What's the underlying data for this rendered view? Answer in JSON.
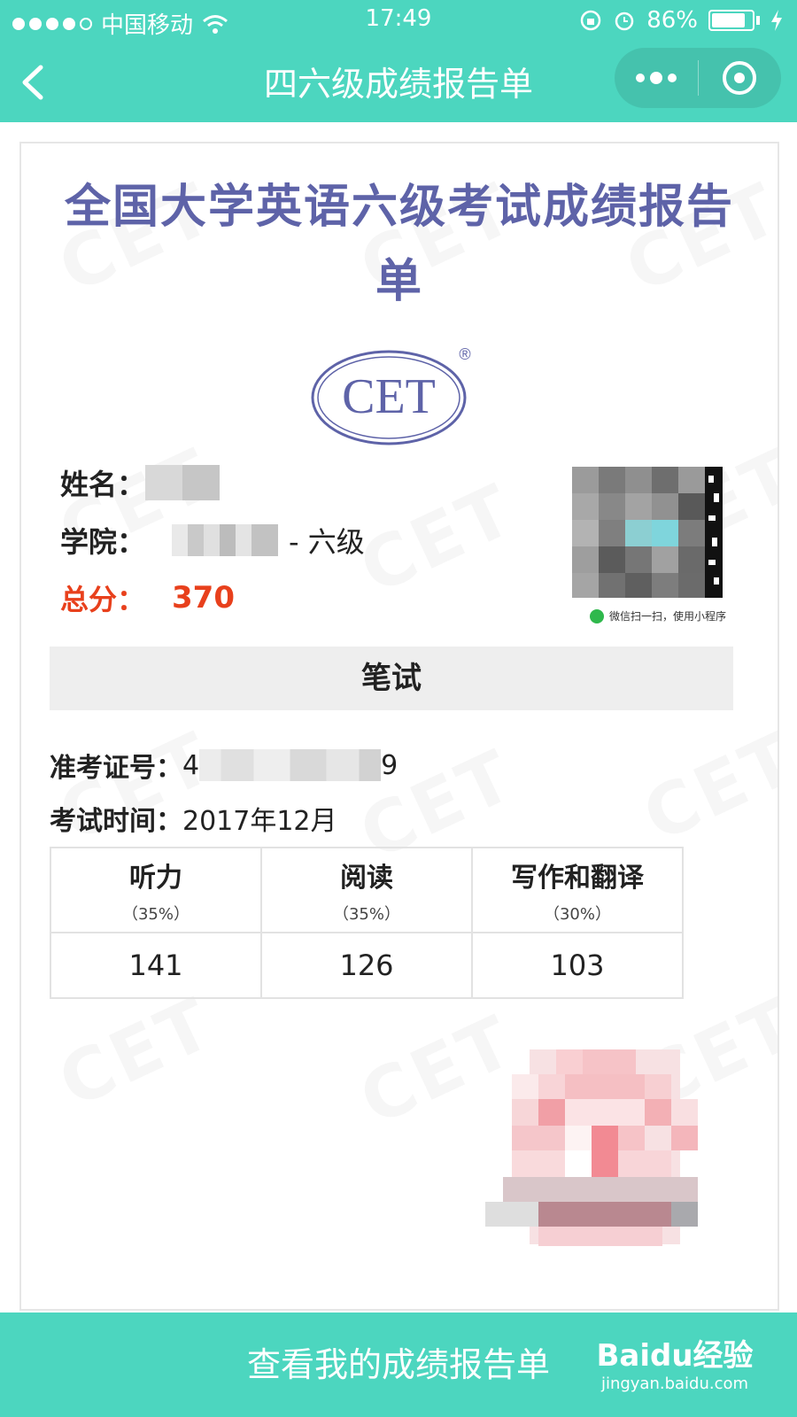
{
  "status_bar": {
    "carrier": "中国移动",
    "time": "17:49",
    "battery": "86%",
    "battery_level": 0.86
  },
  "nav": {
    "title": "四六级成绩报告单"
  },
  "report": {
    "title": "全国大学英语六级考试成绩报告单",
    "logo_text": "CET",
    "logo_mark": "®",
    "name_label": "姓名：",
    "college_label": "学院：",
    "college_suffix": "- 六级",
    "total_label": "总分：",
    "total_value": "370",
    "qr_caption": "微信扫一扫，使用小程序",
    "section_title": "笔试",
    "ticket_label": "准考证号：",
    "ticket_prefix": "4",
    "ticket_suffix": "9",
    "exam_time_label": "考试时间：",
    "exam_time": "2017年12月",
    "scores": [
      {
        "name": "听力",
        "weight": "（35%）",
        "value": "141"
      },
      {
        "name": "阅读",
        "weight": "（35%）",
        "value": "126"
      },
      {
        "name": "写作和翻译",
        "weight": "（30%）",
        "value": "103"
      }
    ]
  },
  "footer": {
    "button_label": "查看我的成绩报告单"
  },
  "watermark": {
    "brand": "Baidu经验",
    "url": "jingyan.baidu.com"
  },
  "colors": {
    "accent": "#4cd6bf",
    "title": "#5e63a8",
    "total": "#e8401c"
  }
}
